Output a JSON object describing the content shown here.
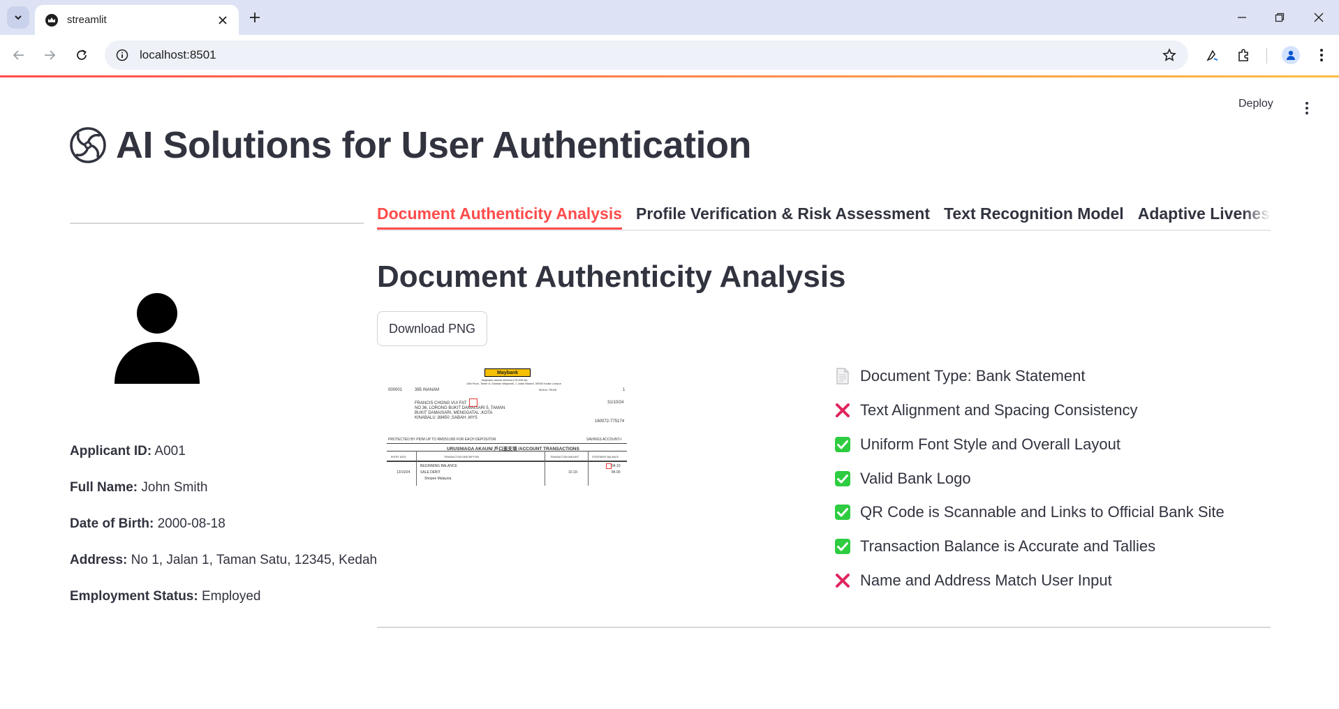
{
  "browser": {
    "tab_title": "streamlit",
    "url": "localhost:8501"
  },
  "header": {
    "deploy_label": "Deploy"
  },
  "app": {
    "title": "AI Solutions for User Authentication"
  },
  "applicant": {
    "fields": [
      {
        "label": "Applicant ID:",
        "value": "A001"
      },
      {
        "label": "Full Name:",
        "value": "John Smith"
      },
      {
        "label": "Date of Birth:",
        "value": "2000-08-18"
      },
      {
        "label": "Address:",
        "value": "No 1, Jalan 1, Taman Satu, 12345, Kedah"
      },
      {
        "label": "Employment Status:",
        "value": "Employed"
      }
    ]
  },
  "tabs": [
    {
      "label": "Document Authenticity Analysis",
      "active": true
    },
    {
      "label": "Profile Verification & Risk Assessment",
      "active": false
    },
    {
      "label": "Text Recognition Model",
      "active": false
    },
    {
      "label": "Adaptive Liveness",
      "active": false
    }
  ],
  "main": {
    "section_title": "Document Authenticity Analysis",
    "download_label": "Download PNG"
  },
  "document": {
    "logo": "Maybank",
    "header_line": "Maybank Islamic Berhad (787435-M)",
    "header_addr": "14th Floor, Tower A, Dataran Maybank, 1 Jalan Maarof, 59000 Kuala Lumpur",
    "code": "000001",
    "branch": "385 INANAM",
    "name_line": "FRANCIS CHONG VUI FAT",
    "addr1": "NO 36, LORONG BUKIT DAMAISARI 5, TAMAN",
    "addr2": "BUKIT DAMAISARI, MENGGATAL ,KOTA",
    "addr3": "KINABALU ,88450 ,SABAH ,MYS",
    "page_label": "MUKA / PAGE",
    "page_value": "1",
    "stmt_date": "31/10/24",
    "account_no": "160072-775174",
    "protected": "PROTECTED BY PIDM UP TO RM250,000 FOR EACH DEPOSITOR",
    "savings": "SAVINGS ACCOUNT-I",
    "table_title": "URUSNIAGA AKAUN/ 戶口進支項 /ACCOUNT TRANSACTIONS",
    "col1": "ENTRY DATE",
    "col2": "TRANSACTION DESCRIPTION",
    "col3": "TRANSACTION AMOUNT",
    "col4": "STATEMENT BALANCE",
    "row1_desc": "BEGINNING BALANCE",
    "row1_bal": "94.10",
    "row2_date": "13/10/24",
    "row2_desc": "SALE DEBIT",
    "row2_amt": "10.10-",
    "row2_bal": "84.00",
    "row3_desc": "Shopee Malaysia"
  },
  "checks": [
    {
      "icon": "page",
      "text": "Document Type: Bank Statement"
    },
    {
      "icon": "cross",
      "text": "Text Alignment and Spacing Consistency"
    },
    {
      "icon": "check",
      "text": "Uniform Font Style and Overall Layout"
    },
    {
      "icon": "check",
      "text": "Valid Bank Logo"
    },
    {
      "icon": "check",
      "text": "QR Code is Scannable and Links to Official Bank Site"
    },
    {
      "icon": "check",
      "text": "Transaction Balance is Accurate and Tallies"
    },
    {
      "icon": "cross",
      "text": "Name and Address Match User Input"
    }
  ],
  "colors": {
    "accent": "#ff4b4b",
    "check_green": "#2ecc40",
    "cross_red": "#e0245e",
    "text": "#31333f"
  }
}
